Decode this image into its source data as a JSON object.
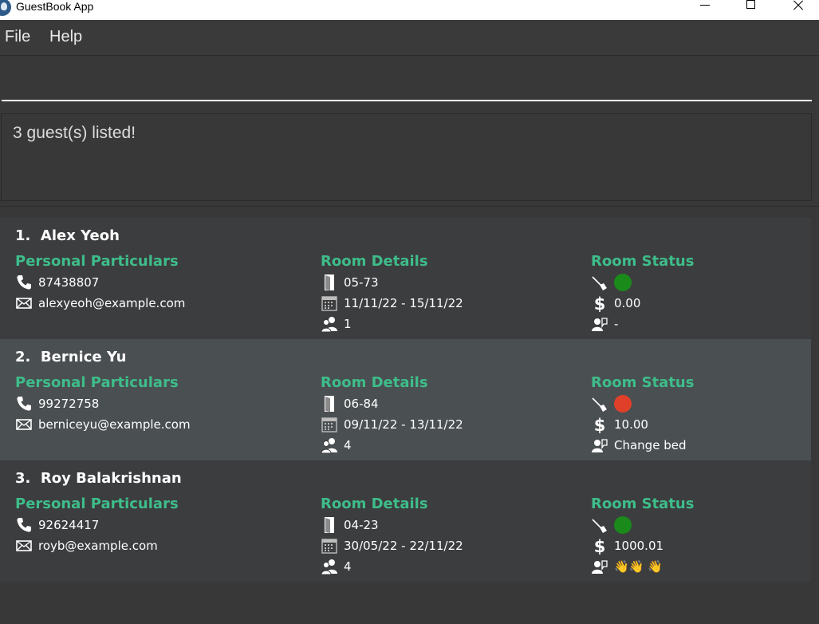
{
  "window": {
    "title": "GuestBook App"
  },
  "menu": {
    "file": "File",
    "help": "Help"
  },
  "command": {
    "value": ""
  },
  "result": {
    "message": "3 guest(s) listed!"
  },
  "colors": {
    "accent": "#3ebd8a",
    "clean": "#1a8a1a",
    "dirty": "#e0402a"
  },
  "guests": [
    {
      "index": "1.",
      "name": "Alex Yeoh",
      "personal_title": "Personal Particulars",
      "phone": "87438807",
      "email": "alexyeoh@example.com",
      "room_title": "Room Details",
      "room": "05-73",
      "dates": "11/11/22 - 15/11/22",
      "guests": "1",
      "status_title": "Room Status",
      "clean_status": "clean",
      "bill": "0.00",
      "request": "-"
    },
    {
      "index": "2.",
      "name": "Bernice Yu",
      "personal_title": "Personal Particulars",
      "phone": "99272758",
      "email": "berniceyu@example.com",
      "room_title": "Room Details",
      "room": "06-84",
      "dates": "09/11/22 - 13/11/22",
      "guests": "4",
      "status_title": "Room Status",
      "clean_status": "dirty",
      "bill": "10.00",
      "request": "Change bed"
    },
    {
      "index": "3.",
      "name": "Roy Balakrishnan",
      "personal_title": "Personal Particulars",
      "phone": "92624417",
      "email": "royb@example.com",
      "room_title": "Room Details",
      "room": "04-23",
      "dates": "30/05/22 - 22/11/22",
      "guests": "4",
      "status_title": "Room Status",
      "clean_status": "clean",
      "bill": "1000.01",
      "request": "👋👋 👋"
    }
  ]
}
